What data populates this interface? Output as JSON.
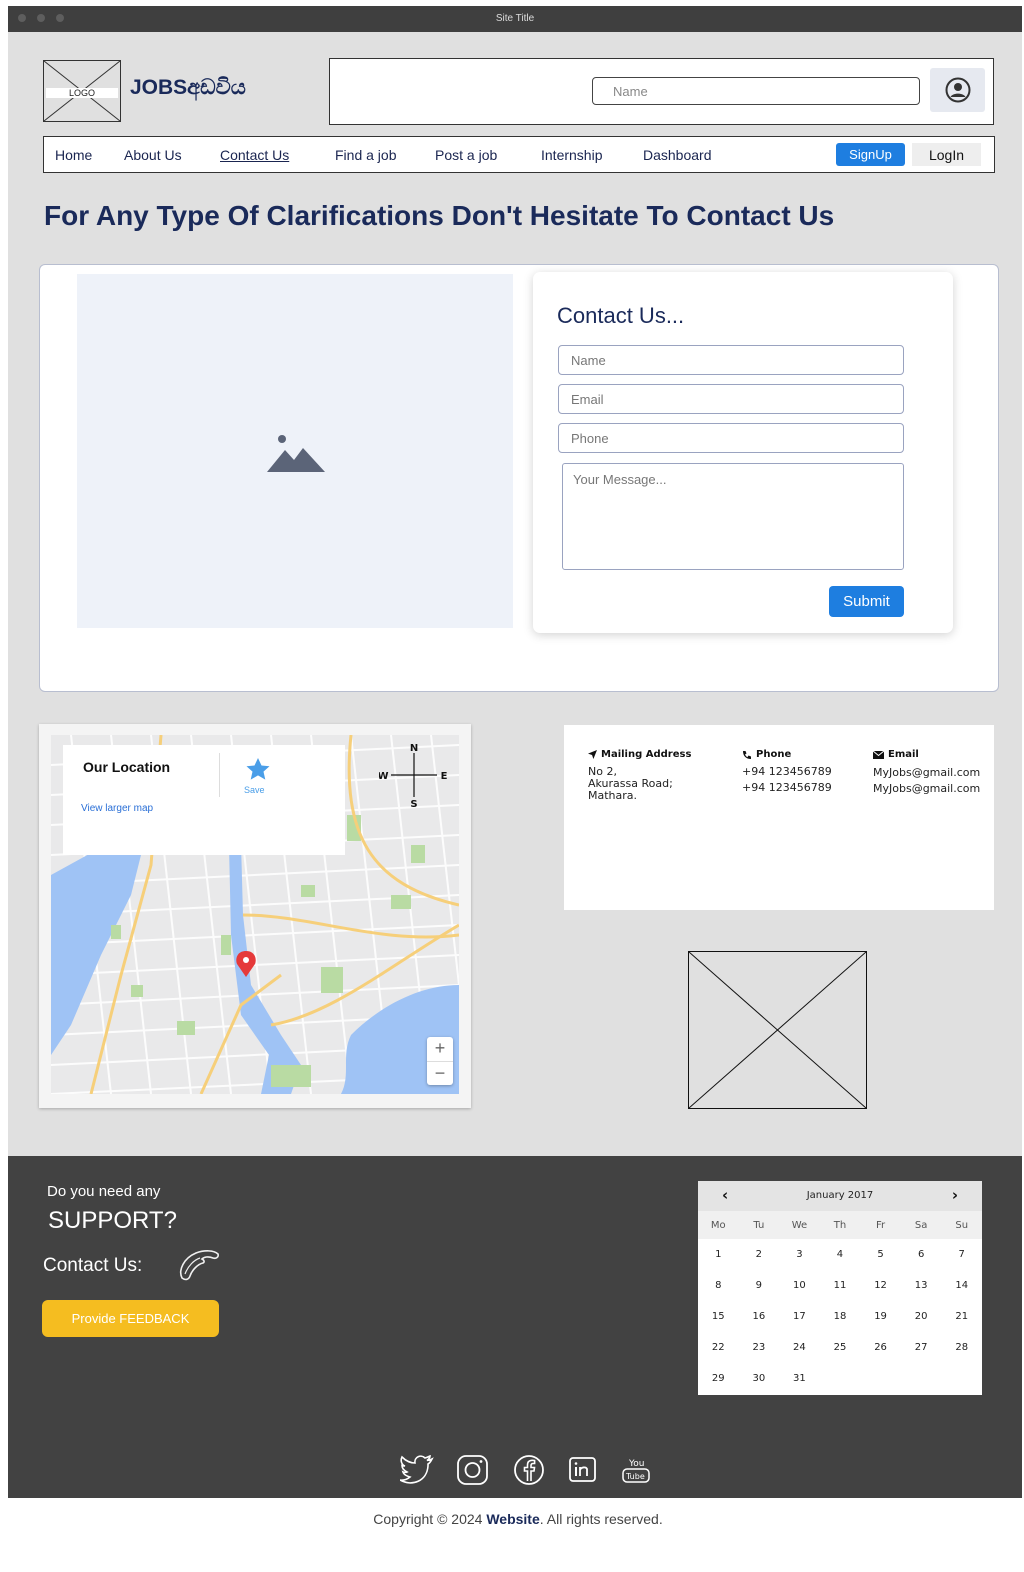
{
  "window": {
    "title": "Site Title"
  },
  "header": {
    "logo_text": "LOGO",
    "brand": "JOBSඅඩවිය",
    "search_placeholder": "Name"
  },
  "nav": {
    "items": [
      "Home",
      "About Us",
      "Contact Us",
      "Find a job",
      "Post a job",
      "Internship",
      "Dashboard"
    ],
    "active": "Contact Us",
    "signup": "SignUp",
    "login": "LogIn"
  },
  "headline": "For Any Type Of Clarifications Don't Hesitate To Contact Us",
  "contact_form": {
    "title": "Contact Us...",
    "name_placeholder": "Name",
    "email_placeholder": "Email",
    "phone_placeholder": "Phone",
    "message_placeholder": "Your Message...",
    "submit": "Submit"
  },
  "map": {
    "title": "Our Location",
    "link": "View larger map",
    "save": "Save",
    "compass": {
      "n": "N",
      "s": "S",
      "e": "E",
      "w": "W"
    },
    "zoom_in": "+",
    "zoom_out": "−"
  },
  "info": {
    "mailing": {
      "heading": "Mailing Address",
      "lines": [
        "No 2,",
        "Akurassa Road;",
        "Mathara."
      ]
    },
    "phone": {
      "heading": "Phone",
      "lines": [
        "+94 123456789",
        "+94 123456789"
      ]
    },
    "email": {
      "heading": "Email",
      "lines": [
        "MyJobs@gmail.com",
        "MyJobs@gmail.com"
      ]
    }
  },
  "footer": {
    "support_small": "Do you need any",
    "support_big": "SUPPORT?",
    "contact_label": "Contact Us:",
    "feedback": "Provide FEEDBACK",
    "socials": [
      "twitter-icon",
      "instagram-icon",
      "facebook-icon",
      "linkedin-icon",
      "youtube-icon"
    ]
  },
  "calendar": {
    "month": "January 2017",
    "prev": "‹",
    "next": "›",
    "weekdays": [
      "Mo",
      "Tu",
      "We",
      "Th",
      "Fr",
      "Sa",
      "Su"
    ],
    "days": [
      "1",
      "2",
      "3",
      "4",
      "5",
      "6",
      "7",
      "8",
      "9",
      "10",
      "11",
      "12",
      "13",
      "14",
      "15",
      "16",
      "17",
      "18",
      "19",
      "20",
      "21",
      "22",
      "23",
      "24",
      "25",
      "26",
      "27",
      "28",
      "29",
      "30",
      "31"
    ]
  },
  "copyright": {
    "prefix": "Copyright © 2024 ",
    "site": "Website",
    "suffix": ". All rights reserved."
  },
  "colors": {
    "accent": "#1e7ee0",
    "navy": "#1a2a5a",
    "footer": "#424242",
    "feedback": "#f5bd20"
  }
}
